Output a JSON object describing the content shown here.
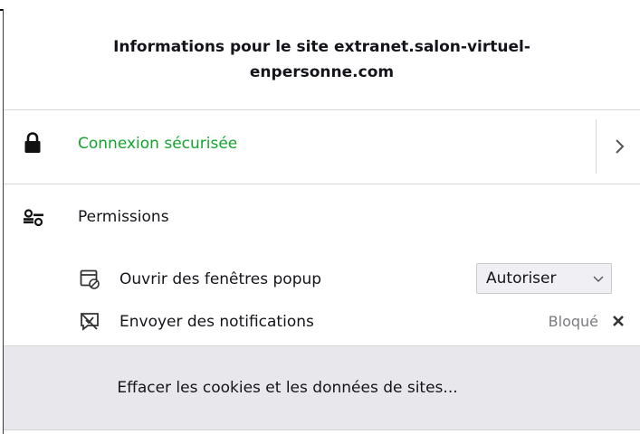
{
  "header": {
    "title": "Informations pour le site extranet.salon-virtuel-enpersonne.com"
  },
  "connection": {
    "label": "Connexion sécurisée",
    "icon": "lock-icon",
    "color": "#12a42e"
  },
  "permissions": {
    "heading": "Permissions",
    "items": [
      {
        "label": "Ouvrir des fenêtres popup",
        "icon": "popup-window-icon",
        "selected": "Autoriser"
      },
      {
        "label": "Envoyer des notifications",
        "icon": "notifications-blocked-icon",
        "status": "Bloqué",
        "clear_icon": "close-icon"
      }
    ]
  },
  "footer": {
    "clear_label": "Effacer les cookies et les données de sites..."
  }
}
